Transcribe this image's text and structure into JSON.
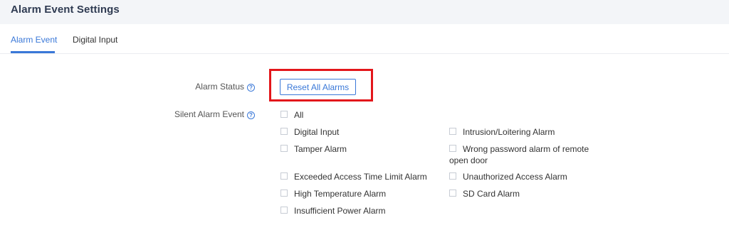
{
  "header": {
    "title": "Alarm Event Settings"
  },
  "tabs": [
    {
      "label": "Alarm Event",
      "active": true
    },
    {
      "label": "Digital Input",
      "active": false
    }
  ],
  "form": {
    "alarm_status": {
      "label": "Alarm Status",
      "button_label": "Reset All Alarms",
      "help_icon": "question-circle-icon"
    },
    "silent_alarm_event": {
      "label": "Silent Alarm Event",
      "help_icon": "question-circle-icon",
      "options": {
        "all": "All",
        "digital_input": "Digital Input",
        "intrusion": "Intrusion/Loitering Alarm",
        "tamper": "Tamper Alarm",
        "wrong_password_line1": "Wrong password alarm of remote",
        "wrong_password_line2": "open door",
        "exceeded_access": "Exceeded Access Time Limit Alarm",
        "unauthorized": "Unauthorized Access Alarm",
        "high_temperature": "High Temperature Alarm",
        "sd_card": "SD Card Alarm",
        "insufficient_power": "Insufficient Power Alarm"
      }
    }
  },
  "colors": {
    "accent": "#3a78d8",
    "highlight": "#e3161b",
    "header_bg": "#f3f5f8"
  }
}
